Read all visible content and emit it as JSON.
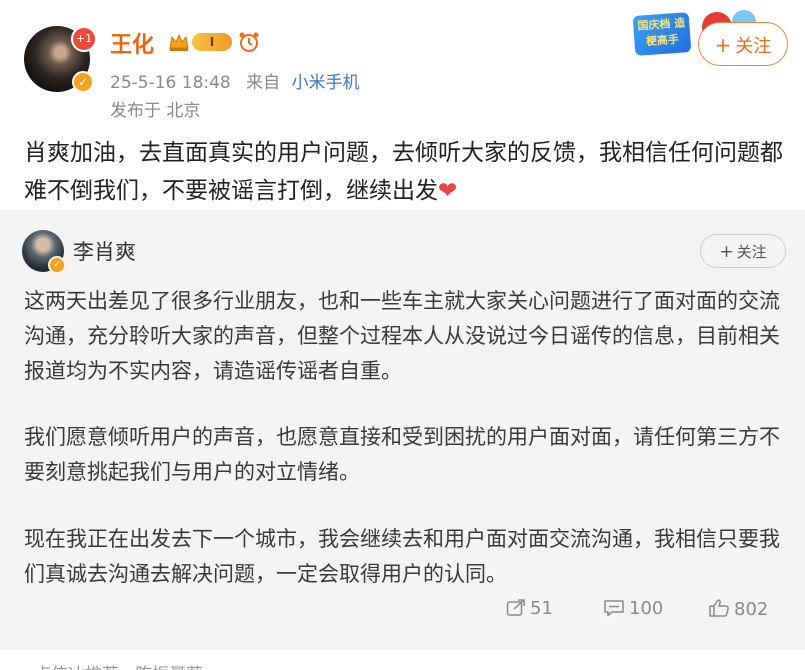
{
  "post": {
    "author": {
      "name": "王化",
      "avatar_badge": "+1",
      "level_badge": "I",
      "verified_icon": "verified-icon"
    },
    "time": "25-5-16 18:48",
    "source_prefix": "来自",
    "source": "小米手机",
    "location": "发布于 北京",
    "follow_label": "关注",
    "event_badge_text": "国庆档 造梗高手",
    "text": "肖爽加油，去直面真实的用户问题，去倾听大家的反馈，我相信任何问题都难不倒我们，不要被谣言打倒，继续出发",
    "heart": "❤"
  },
  "repost": {
    "author": {
      "name": "李肖爽"
    },
    "follow_label": "关注",
    "paragraphs": [
      "这两天出差见了很多行业朋友，也和一些车主就大家关心问题进行了面对面的交流沟通，充分聆听大家的声音，但整个过程本人从没说过今日谣传的信息，目前相关报道均为不实内容，请造谣传谣者自重。",
      "我们愿意倾听用户的声音，也愿意直接和受到困扰的用户面对面，请任何第三方不要刻意挑起我们与用户的对立情绪。",
      "现在我正在出发去下一个城市，我会继续去和用户面对面交流沟通，我相信只要我们真诚去沟通去解决问题，一定会取得用户的认同。"
    ],
    "stats": {
      "reposts": "51",
      "comments": "100",
      "likes": "802"
    }
  },
  "bottom_strip_text": "卢伟冰推荐 · 陈振聂蔚"
}
